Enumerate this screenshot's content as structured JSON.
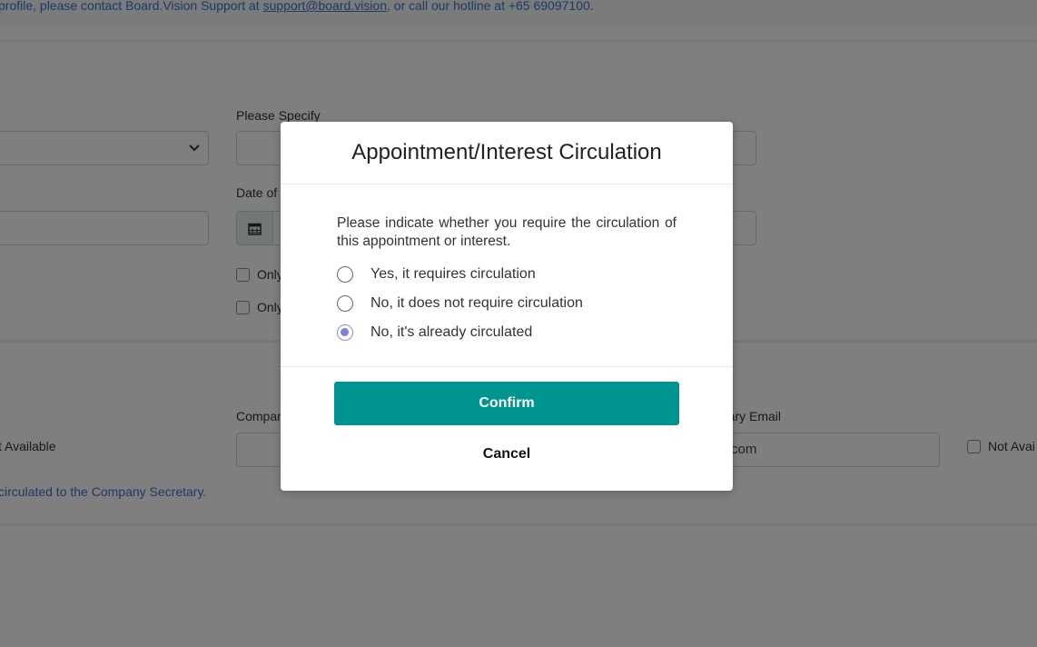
{
  "background": {
    "notice": {
      "prefix": "profile, please contact Board.Vision Support at ",
      "email": "support@board.vision",
      "suffix": ", or call our hotline at +65 69097100."
    },
    "section1": {
      "please_specify_label": "Please Specify",
      "date_label": "Date of",
      "checkbox1_label": "Only",
      "checkbox2_label": "Only"
    },
    "section2": {
      "not_available_left": "t Available",
      "company_label": "Compar",
      "secretary_email_label": "etary Email",
      "secretary_email_value": "com",
      "not_available_right": "Not Avai",
      "circulated_note": "circulated to the Company Secretary."
    }
  },
  "modal": {
    "title": "Appointment/Interest Circulation",
    "prompt": "Please indicate whether you require the circulation of this appointment or interest.",
    "options": [
      {
        "label": "Yes, it requires circulation",
        "selected": false
      },
      {
        "label": "No, it does not require circulation",
        "selected": false
      },
      {
        "label": "No, it's already circulated",
        "selected": true
      }
    ],
    "confirm_label": "Confirm",
    "cancel_label": "Cancel"
  },
  "colors": {
    "accent": "#009490",
    "link": "#3c73c4",
    "radio_selected": "#7f7fe0",
    "overlay": "rgba(0,0,0,0.5)"
  }
}
